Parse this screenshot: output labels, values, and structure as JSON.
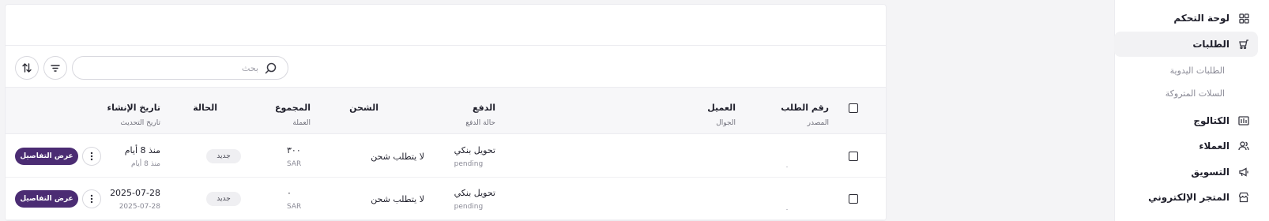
{
  "sidebar": {
    "items": [
      {
        "label": "لوحة التحكم",
        "icon": "dashboard-icon"
      },
      {
        "label": "الطلبات",
        "icon": "cart-icon",
        "active": true
      },
      {
        "label": "الكتالوج",
        "icon": "catalog-icon"
      },
      {
        "label": "العملاء",
        "icon": "users-icon"
      },
      {
        "label": "التسويق",
        "icon": "megaphone-icon"
      },
      {
        "label": "المتجر الإلكتروني",
        "icon": "store-icon"
      }
    ],
    "sub_items": [
      "الطلبات اليدوية",
      "السلات المتروكة"
    ]
  },
  "toolbar": {
    "search_placeholder": "بحث",
    "search_icon": "search-icon",
    "filter_icon": "filter-icon",
    "sort_icon": "sort-icon"
  },
  "table": {
    "headers": {
      "order_number": "رقم الطلب",
      "source": "المصدر",
      "customer": "العميل",
      "mobile": "الجوال",
      "payment": "الدفع",
      "payment_status": "حالة الدفع",
      "shipping": "الشحن",
      "total": "المجموع",
      "currency": "العملة",
      "status": "الحالة",
      "created_at": "تاريخ الإنشاء",
      "updated_at": "تاريخ التحديث"
    },
    "rows": [
      {
        "payment": "تحويل بنكي",
        "payment_status": "pending",
        "shipping": "لا يتطلب شحن",
        "total": "٣٠٠",
        "currency": "SAR",
        "status": "جديد",
        "created_at": "منذ 8 أيام",
        "updated_at": "منذ 8 أيام",
        "details_label": "عرض التفاصيل"
      },
      {
        "payment": "تحويل بنكي",
        "payment_status": "pending",
        "shipping": "لا يتطلب شحن",
        "total": "٠",
        "currency": "SAR",
        "status": "جديد",
        "created_at": "2025-07-28",
        "updated_at": "2025-07-28",
        "details_label": "عرض التفاصيل"
      }
    ]
  },
  "colors": {
    "accent": "#4b2c73",
    "badge_bg": "#efeff2",
    "header_bg": "#f7f7f9"
  }
}
